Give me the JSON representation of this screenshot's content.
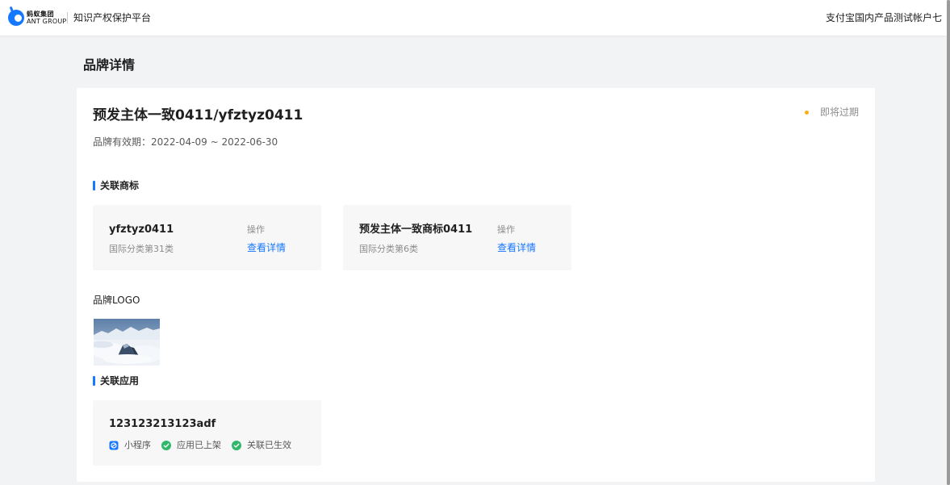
{
  "header": {
    "logo_cn": "蚂蚁集团",
    "logo_en": "ANT GROUP",
    "platform_name": "知识产权保护平台",
    "account_name": "支付宝国内产品测试帐户七"
  },
  "page": {
    "title": "品牌详情"
  },
  "brand": {
    "name": "预发主体一致0411/yfztyz0411",
    "status": "即将过期",
    "validity_label": "品牌有效期：",
    "validity_range": "2022-04-09 ~ 2022-06-30"
  },
  "sections": {
    "trademarks_title": "关联商标",
    "logo_title": "品牌LOGO",
    "apps_title": "关联应用"
  },
  "trademarks": [
    {
      "name": "yfztyz0411",
      "class": "国际分类第31类",
      "op_label": "操作",
      "link": "查看详情"
    },
    {
      "name": "预发主体一致商标0411",
      "class": "国际分类第6类",
      "op_label": "操作",
      "link": "查看详情"
    }
  ],
  "app": {
    "name": "123123213123adf",
    "tags": [
      "小程序",
      "应用已上架",
      "关联已生效"
    ]
  },
  "colors": {
    "accent": "#1677ff",
    "status_warning": "#faad14",
    "success": "#2fb86a",
    "section_bar": "#1677ff"
  },
  "icons": {
    "mini_program": "mini-program-icon",
    "check": "check-circle-icon"
  }
}
